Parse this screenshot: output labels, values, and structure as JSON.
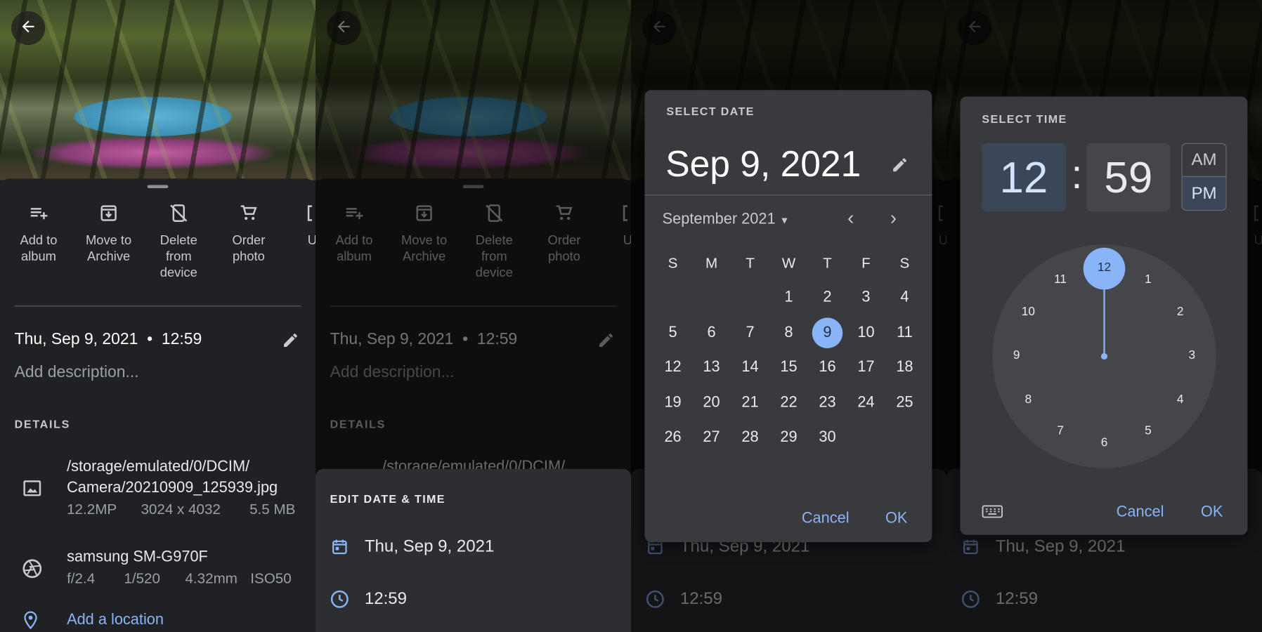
{
  "colors": {
    "accent": "#8ab4f8",
    "background": "#202124",
    "dialog": "#393a3e"
  },
  "actions": [
    {
      "label1": "Add to",
      "label2": "album",
      "label3": "",
      "icon": "playlist-add-icon"
    },
    {
      "label1": "Move to",
      "label2": "Archive",
      "label3": "",
      "icon": "archive-icon"
    },
    {
      "label1": "Delete",
      "label2": "from",
      "label3": "device",
      "icon": "mobile-off-icon"
    },
    {
      "label1": "Order",
      "label2": "photo",
      "label3": "",
      "icon": "cart-icon"
    },
    {
      "label1": "Us",
      "label2": "",
      "label3": "",
      "icon": "use-as-icon"
    }
  ],
  "info": {
    "datetime": "Thu, Sep 9, 2021  •  12:59",
    "description_placeholder": "Add description...",
    "details_heading": "DETAILS",
    "path_line1": "/storage/emulated/0/DCIM/",
    "path_line2": "Camera/20210909_125939.jpg",
    "megapixels": "12.2MP",
    "resolution": "3024 x 4032",
    "size": "5.5 MB",
    "camera": "samsung SM-G970F",
    "aperture": "f/2.4",
    "shutter": "1/520",
    "focal": "4.32mm",
    "iso": "ISO50",
    "location": "Add a location"
  },
  "edit_sheet": {
    "title": "EDIT DATE & TIME",
    "date": "Thu, Sep 9, 2021",
    "time": "12:59"
  },
  "date_picker": {
    "title": "SELECT DATE",
    "selected": "Sep 9, 2021",
    "month": "September 2021",
    "weekdays": [
      "S",
      "M",
      "T",
      "W",
      "T",
      "F",
      "S"
    ],
    "first_weekday": 3,
    "days_in_month": 30,
    "selected_day": 9,
    "cancel": "Cancel",
    "ok": "OK"
  },
  "time_picker": {
    "title": "SELECT TIME",
    "hour": "12",
    "separator": ":",
    "minute": "59",
    "am": "AM",
    "pm": "PM",
    "period": "PM",
    "selected_hour": 12,
    "hours": [
      "12",
      "1",
      "2",
      "3",
      "4",
      "5",
      "6",
      "7",
      "8",
      "9",
      "10",
      "11"
    ],
    "cancel": "Cancel",
    "ok": "OK"
  }
}
